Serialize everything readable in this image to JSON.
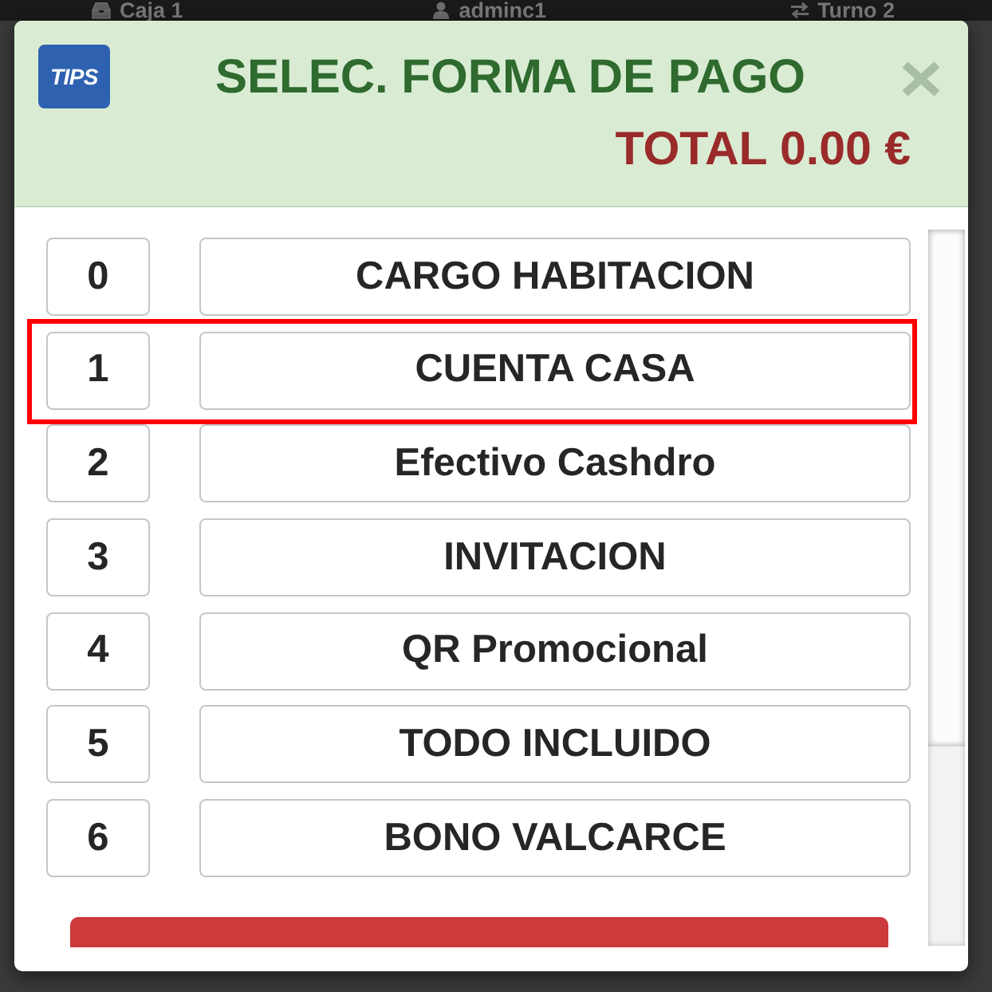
{
  "top_bar": {
    "till": "Caja 1",
    "user": "adminc1",
    "shift": "Turno 2"
  },
  "dialog": {
    "logo": "TIPS",
    "title": "SELEC. FORMA DE PAGO",
    "total": "TOTAL 0.00 €"
  },
  "options": [
    {
      "number": "0",
      "label": "CARGO HABITACION",
      "selected": false
    },
    {
      "number": "1",
      "label": "CUENTA CASA",
      "selected": true
    },
    {
      "number": "2",
      "label": "Efectivo Cashdro",
      "selected": false
    },
    {
      "number": "3",
      "label": "INVITACION",
      "selected": false
    },
    {
      "number": "4",
      "label": "QR Promocional",
      "selected": false
    },
    {
      "number": "5",
      "label": "TODO INCLUIDO",
      "selected": false
    },
    {
      "number": "6",
      "label": "BONO VALCARCE",
      "selected": false
    }
  ]
}
